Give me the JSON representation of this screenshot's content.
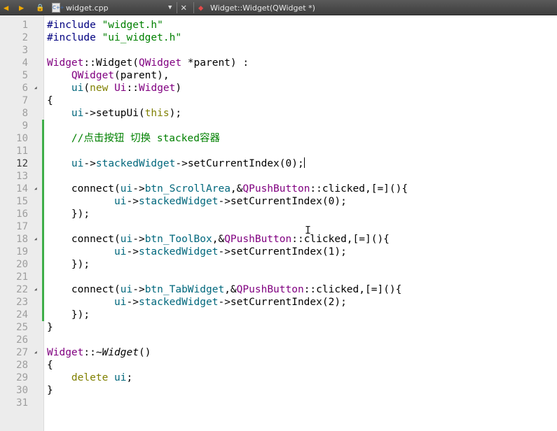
{
  "toolbar": {
    "file_icon_label": "C++",
    "file_name": "widget.cpp",
    "symbol": "Widget::Widget(QWidget *)"
  },
  "editor": {
    "current_line": 12,
    "lines": [
      {
        "n": "1",
        "fold": false,
        "changed": false,
        "tokens": [
          {
            "t": "#include ",
            "c": "p"
          },
          {
            "t": "\"widget.h\"",
            "c": "s"
          }
        ]
      },
      {
        "n": "2",
        "fold": false,
        "changed": false,
        "tokens": [
          {
            "t": "#include ",
            "c": "p"
          },
          {
            "t": "\"ui_widget.h\"",
            "c": "s"
          }
        ]
      },
      {
        "n": "3",
        "fold": false,
        "changed": false,
        "tokens": []
      },
      {
        "n": "4",
        "fold": false,
        "changed": false,
        "tokens": [
          {
            "t": "Widget",
            "c": "t"
          },
          {
            "t": "::Widget(",
            "c": ""
          },
          {
            "t": "QWidget",
            "c": "t"
          },
          {
            "t": " *parent) :",
            "c": ""
          }
        ]
      },
      {
        "n": "5",
        "fold": false,
        "changed": false,
        "tokens": [
          {
            "t": "    ",
            "c": ""
          },
          {
            "t": "QWidget",
            "c": "t"
          },
          {
            "t": "(parent),",
            "c": ""
          }
        ]
      },
      {
        "n": "6",
        "fold": true,
        "changed": false,
        "tokens": [
          {
            "t": "    ",
            "c": ""
          },
          {
            "t": "ui",
            "c": "f"
          },
          {
            "t": "(",
            "c": ""
          },
          {
            "t": "new",
            "c": "k"
          },
          {
            "t": " ",
            "c": ""
          },
          {
            "t": "Ui",
            "c": "t"
          },
          {
            "t": "::",
            "c": ""
          },
          {
            "t": "Widget",
            "c": "t"
          },
          {
            "t": ")",
            "c": ""
          }
        ]
      },
      {
        "n": "7",
        "fold": false,
        "changed": false,
        "tokens": [
          {
            "t": "{",
            "c": ""
          }
        ]
      },
      {
        "n": "8",
        "fold": false,
        "changed": false,
        "tokens": [
          {
            "t": "    ",
            "c": ""
          },
          {
            "t": "ui",
            "c": "f"
          },
          {
            "t": "->setupUi(",
            "c": ""
          },
          {
            "t": "this",
            "c": "k"
          },
          {
            "t": ");",
            "c": ""
          }
        ]
      },
      {
        "n": "9",
        "fold": false,
        "changed": true,
        "tokens": []
      },
      {
        "n": "10",
        "fold": false,
        "changed": true,
        "tokens": [
          {
            "t": "    ",
            "c": ""
          },
          {
            "t": "//点击按钮 切换 stacked容器",
            "c": "c"
          }
        ]
      },
      {
        "n": "11",
        "fold": false,
        "changed": true,
        "tokens": []
      },
      {
        "n": "12",
        "fold": false,
        "changed": true,
        "caret": true,
        "tokens": [
          {
            "t": "    ",
            "c": ""
          },
          {
            "t": "ui",
            "c": "f"
          },
          {
            "t": "->",
            "c": ""
          },
          {
            "t": "stackedWidget",
            "c": "f"
          },
          {
            "t": "->setCurrentIndex(0);",
            "c": ""
          }
        ]
      },
      {
        "n": "13",
        "fold": false,
        "changed": true,
        "tokens": []
      },
      {
        "n": "14",
        "fold": true,
        "changed": true,
        "tokens": [
          {
            "t": "    connect(",
            "c": ""
          },
          {
            "t": "ui",
            "c": "f"
          },
          {
            "t": "->",
            "c": ""
          },
          {
            "t": "btn_ScrollArea",
            "c": "f"
          },
          {
            "t": ",&",
            "c": ""
          },
          {
            "t": "QPushButton",
            "c": "t"
          },
          {
            "t": "::clicked,[=](){",
            "c": ""
          }
        ]
      },
      {
        "n": "15",
        "fold": false,
        "changed": true,
        "tokens": [
          {
            "t": "           ",
            "c": ""
          },
          {
            "t": "ui",
            "c": "f"
          },
          {
            "t": "->",
            "c": ""
          },
          {
            "t": "stackedWidget",
            "c": "f"
          },
          {
            "t": "->setCurrentIndex(0);",
            "c": ""
          }
        ]
      },
      {
        "n": "16",
        "fold": false,
        "changed": true,
        "tokens": [
          {
            "t": "    });",
            "c": ""
          }
        ]
      },
      {
        "n": "17",
        "fold": false,
        "changed": true,
        "tokens": []
      },
      {
        "n": "18",
        "fold": true,
        "changed": true,
        "tokens": [
          {
            "t": "    connect(",
            "c": ""
          },
          {
            "t": "ui",
            "c": "f"
          },
          {
            "t": "->",
            "c": ""
          },
          {
            "t": "btn_ToolBox",
            "c": "f"
          },
          {
            "t": ",&",
            "c": ""
          },
          {
            "t": "QPushButton",
            "c": "t"
          },
          {
            "t": "::clicked,[=](){",
            "c": ""
          }
        ]
      },
      {
        "n": "19",
        "fold": false,
        "changed": true,
        "tokens": [
          {
            "t": "           ",
            "c": ""
          },
          {
            "t": "ui",
            "c": "f"
          },
          {
            "t": "->",
            "c": ""
          },
          {
            "t": "stackedWidget",
            "c": "f"
          },
          {
            "t": "->setCurrentIndex(1);",
            "c": ""
          }
        ]
      },
      {
        "n": "20",
        "fold": false,
        "changed": true,
        "tokens": [
          {
            "t": "    });",
            "c": ""
          }
        ]
      },
      {
        "n": "21",
        "fold": false,
        "changed": true,
        "tokens": []
      },
      {
        "n": "22",
        "fold": true,
        "changed": true,
        "tokens": [
          {
            "t": "    connect(",
            "c": ""
          },
          {
            "t": "ui",
            "c": "f"
          },
          {
            "t": "->",
            "c": ""
          },
          {
            "t": "btn_TabWidget",
            "c": "f"
          },
          {
            "t": ",&",
            "c": ""
          },
          {
            "t": "QPushButton",
            "c": "t"
          },
          {
            "t": "::clicked,[=](){",
            "c": ""
          }
        ]
      },
      {
        "n": "23",
        "fold": false,
        "changed": true,
        "tokens": [
          {
            "t": "           ",
            "c": ""
          },
          {
            "t": "ui",
            "c": "f"
          },
          {
            "t": "->",
            "c": ""
          },
          {
            "t": "stackedWidget",
            "c": "f"
          },
          {
            "t": "->setCurrentIndex(2);",
            "c": ""
          }
        ]
      },
      {
        "n": "24",
        "fold": false,
        "changed": true,
        "tokens": [
          {
            "t": "    });",
            "c": ""
          }
        ]
      },
      {
        "n": "25",
        "fold": false,
        "changed": false,
        "tokens": [
          {
            "t": "}",
            "c": ""
          }
        ]
      },
      {
        "n": "26",
        "fold": false,
        "changed": false,
        "tokens": []
      },
      {
        "n": "27",
        "fold": true,
        "changed": false,
        "tokens": [
          {
            "t": "Widget",
            "c": "t"
          },
          {
            "t": "::~",
            "c": ""
          },
          {
            "t": "Widget",
            "c": "i"
          },
          {
            "t": "()",
            "c": ""
          }
        ]
      },
      {
        "n": "28",
        "fold": false,
        "changed": false,
        "tokens": [
          {
            "t": "{",
            "c": ""
          }
        ]
      },
      {
        "n": "29",
        "fold": false,
        "changed": false,
        "tokens": [
          {
            "t": "    ",
            "c": ""
          },
          {
            "t": "delete",
            "c": "k"
          },
          {
            "t": " ",
            "c": ""
          },
          {
            "t": "ui",
            "c": "f"
          },
          {
            "t": ";",
            "c": ""
          }
        ]
      },
      {
        "n": "30",
        "fold": false,
        "changed": false,
        "tokens": [
          {
            "t": "}",
            "c": ""
          }
        ]
      },
      {
        "n": "31",
        "fold": false,
        "changed": false,
        "tokens": []
      }
    ]
  }
}
